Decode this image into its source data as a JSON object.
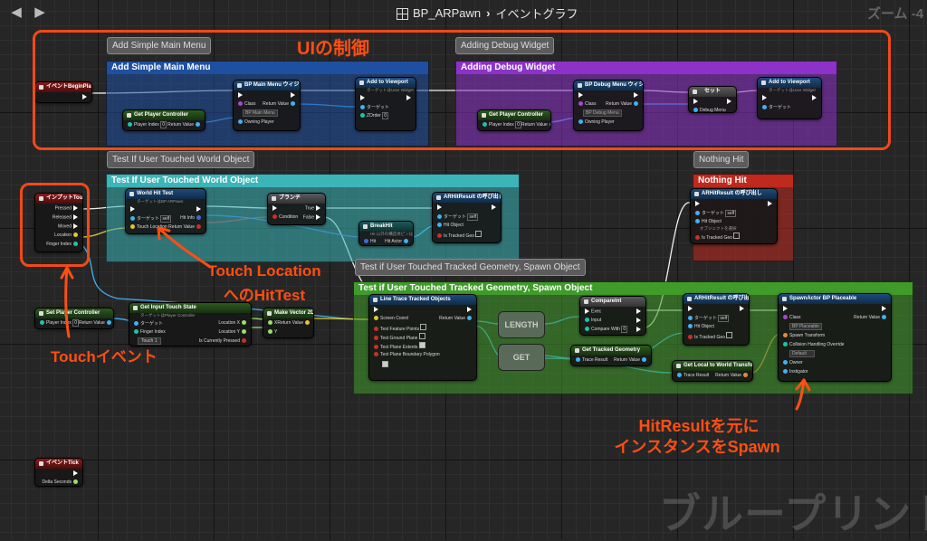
{
  "topbar": {
    "blueprint_name": "BP_ARPawn",
    "separator": "›",
    "graph_name": "イベントグラフ",
    "zoom_label": "ズーム -4"
  },
  "watermark": "ブループリント",
  "comments": {
    "main_menu": "Add Simple Main Menu",
    "debug_widget": "Adding Debug Widget",
    "world_object": "Test If User Touched World Object",
    "nothing_hit": "Nothing Hit",
    "tracked_geometry": "Test if User Touched Tracked Geometry, Spawn Object"
  },
  "nodes": {
    "begin_play": {
      "title": "イベントBeginPlay"
    },
    "get_pc1": {
      "title": "Get Player Controller",
      "player_index": "Player Index",
      "return_value": "Return Value",
      "index_value": "0"
    },
    "create_main_menu": {
      "title": "BP Main Menu ウィジェットを作成",
      "class": "Class",
      "class_value": "BP Main Menu",
      "owning_player": "Owning Player",
      "return_value": "Return Value"
    },
    "add_viewport1": {
      "title": "Add to Viewport",
      "subtitle": "ターゲットはUser Widget",
      "target": "ターゲット",
      "zorder": "ZOrder",
      "zorder_value": "0"
    },
    "get_pc2": {
      "title": "Get Player Controller",
      "player_index": "Player Index",
      "return_value": "Return Value",
      "index_value": "0"
    },
    "create_debug_menu": {
      "title": "BP Debug Menu ウィジェットを作成",
      "class": "Class",
      "class_value": "BP Debug Menu",
      "owning_player": "Owning Player",
      "return_value": "Return Value"
    },
    "set_debug": {
      "title": "セット",
      "debug_menu": "Debug Menu"
    },
    "add_viewport2": {
      "title": "Add to Viewport",
      "subtitle": "ターゲットはUser Widget",
      "target": "ターゲット"
    },
    "input_touch": {
      "title": "インプットTouch",
      "pressed": "Pressed",
      "released": "Released",
      "moved": "Moved",
      "location": "Location",
      "finger_index": "Finger Index"
    },
    "world_hit_test": {
      "title": "World Hit Test",
      "subtitle": "ターゲットはBP ARPawn",
      "target": "ターゲット",
      "self": "self",
      "touch_location": "Touch Location",
      "hit_info": "Hit Info",
      "return_value": "Return Value"
    },
    "branch": {
      "title": "ブランチ",
      "condition": "Condition",
      "true": "True",
      "false": "False"
    },
    "call_hit_result": {
      "title": "ARHitResult の呼び出し",
      "target": "ターゲット",
      "self": "self",
      "hit_object": "Hit Object",
      "is_tracked_geo": "Is Tracked Geo"
    },
    "break_hit": {
      "title": "BreakHit",
      "subtitle": "Hit 以外の構造体ピンは非表示",
      "hit": "Hit",
      "hit_actor": "Hit Actor"
    },
    "nothing_call": {
      "title": "ARHitResult の呼び出し",
      "target": "ターゲット",
      "self": "self",
      "hit_object": "Hit Object",
      "hit_object_sub": "オブジェクトを選択",
      "is_tracked_geo": "Is Tracked Geo"
    },
    "get_pc3": {
      "title": "Set Player Controller",
      "player_index": "Player Index",
      "return_value": "Return Value",
      "index_value": "0"
    },
    "get_input_touch_state": {
      "title": "Get Input Touch State",
      "subtitle": "ターゲットはPlayer Controller",
      "target": "ターゲット",
      "finger_index": "Finger Index",
      "finger_value": "Touch 1",
      "location_x": "Location X",
      "location_y": "Location Y",
      "is_pressed": "Is Currently Pressed"
    },
    "make_vector2d": {
      "title": "Make Vector 2D",
      "x": "X",
      "y": "Y",
      "return_value": "Return Value"
    },
    "line_trace": {
      "title": "Line Trace Tracked Objects",
      "screen_coord": "Screen Coord",
      "test_feature_points": "Test Feature Points",
      "test_ground_plane": "Test Ground Plane",
      "test_plane_extents": "Test Plane Extents",
      "test_plane_boundary": "Test Plane Boundary Polygon",
      "return_value": "Return Value"
    },
    "length": {
      "title": "LENGTH"
    },
    "get": {
      "title": "GET"
    },
    "compare_int": {
      "title": "CompareInt",
      "exec": "Exec",
      "input": "Input",
      "compare_with": "Compare With",
      "compare_value": "0"
    },
    "get_tracked_geometry": {
      "title": "Get Tracked Geometry",
      "trace_result": "Trace Result",
      "return_value": "Return Value"
    },
    "get_local_to_world": {
      "title": "Get Local to World Transform",
      "trace_result": "Trace Result",
      "return_value": "Return Value"
    },
    "call_hit_result2": {
      "title": "ARHitResult の呼び出し",
      "target": "ターゲット",
      "self": "self",
      "hit_object": "Hit Object",
      "is_tracked_geo": "Is Tracked Geo"
    },
    "spawn_actor": {
      "title": "SpawnActor BP Placeable",
      "class": "Class",
      "class_value": "BP Placeable",
      "spawn_transform": "Spawn Transform",
      "collision": "Collision Handling Override",
      "collision_value": "Default",
      "owner": "Owner",
      "instigator": "Instigator",
      "return_value": "Return Value"
    },
    "event_tick": {
      "title": "イベントTick",
      "delta_seconds": "Delta Seconds"
    }
  },
  "annotations": {
    "ui_control": "UIの制御",
    "touch_hittest_1": "Touch Location",
    "touch_hittest_2": "へのHitTest",
    "touch_event": "Touchイベント",
    "spawn_1": "HitResultを元に",
    "spawn_2": "インスタンスをSpawn"
  },
  "colors": {
    "annotation": "#ff4e12",
    "comment_blue": "#1f4fa0",
    "comment_purple": "#8c32c8",
    "comment_teal": "#3bb5b8",
    "comment_red": "#c0291d",
    "comment_green": "#3f9b2a"
  }
}
